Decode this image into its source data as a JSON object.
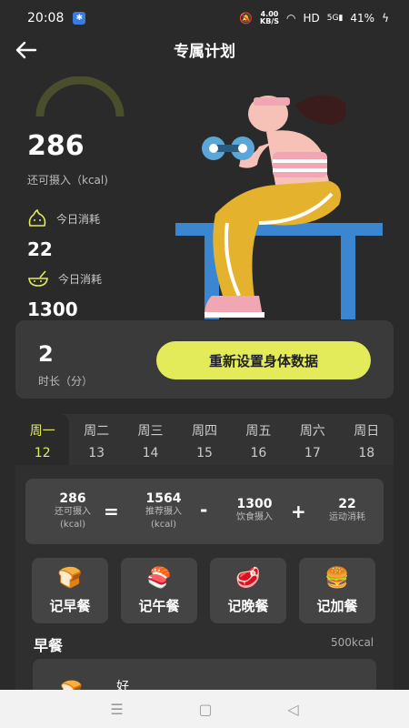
{
  "status": {
    "time": "20:08",
    "speed_top": "4.00",
    "speed_bottom": "KB/S",
    "network": "HD",
    "signal": "5G",
    "battery": "41%"
  },
  "header": {
    "title": "专属计划"
  },
  "remaining": {
    "value": "286",
    "label": "还可摄入（kcal)"
  },
  "burn1": {
    "label": "今日消耗",
    "value": "22"
  },
  "burn2": {
    "label": "今日消耗",
    "value": "1300"
  },
  "duration": {
    "value": "2",
    "label": "时长（分）",
    "button": "重新设置身体数据"
  },
  "week": [
    {
      "day": "周一",
      "date": "12",
      "active": true
    },
    {
      "day": "周二",
      "date": "13"
    },
    {
      "day": "周三",
      "date": "14"
    },
    {
      "day": "周四",
      "date": "15"
    },
    {
      "day": "周五",
      "date": "16"
    },
    {
      "day": "周六",
      "date": "17"
    },
    {
      "day": "周日",
      "date": "18"
    }
  ],
  "formula": {
    "remain": {
      "value": "286",
      "label1": "还可摄入",
      "label2": "(kcal)"
    },
    "eq": "=",
    "recommend": {
      "value": "1564",
      "label1": "推荐摄入",
      "label2": "(kcal)"
    },
    "minus": "-",
    "diet": {
      "value": "1300",
      "label": "饮食摄入"
    },
    "plus": "+",
    "sport": {
      "value": "22",
      "label": "运动消耗"
    }
  },
  "meals": [
    {
      "label": "记早餐",
      "icon": "toast-icon"
    },
    {
      "label": "记午餐",
      "icon": "sushi-icon"
    },
    {
      "label": "记晚餐",
      "icon": "steak-icon"
    },
    {
      "label": "记加餐",
      "icon": "burger-icon"
    }
  ],
  "breakfast": {
    "title": "早餐",
    "kcal": "500kcal",
    "item": "好"
  },
  "colors": {
    "accent": "#e3eb5a",
    "background": "#2a2a2a",
    "card": "#3a3a3a"
  }
}
